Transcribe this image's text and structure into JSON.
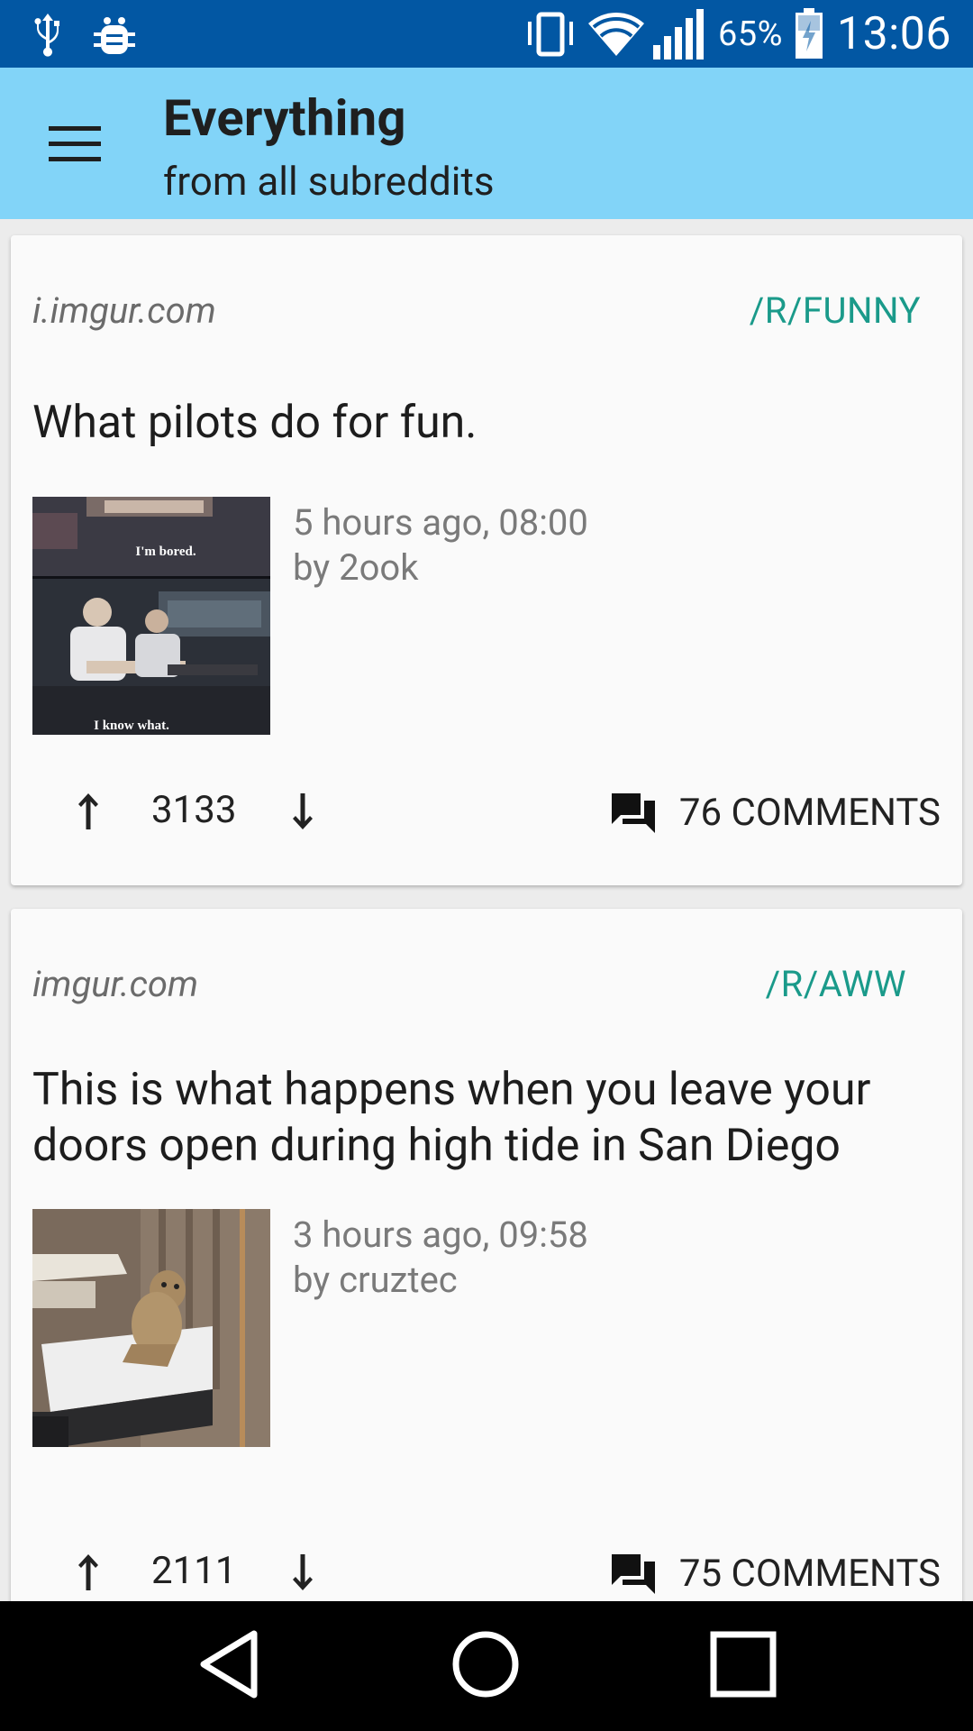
{
  "status_bar": {
    "icons_left": [
      "usb-icon",
      "bug-icon"
    ],
    "icons_right": [
      "vibrate-icon",
      "wifi-icon",
      "signal-icon",
      "battery-charging-icon"
    ],
    "battery_percent": "65%",
    "time": "13:06"
  },
  "app_bar": {
    "menu_icon": "hamburger-menu-icon",
    "title": "Everything",
    "subtitle": "from all subreddits"
  },
  "posts": [
    {
      "domain": "i.imgur.com",
      "subreddit": "/R/FUNNY",
      "title": "What pilots do for fun.",
      "thumbnail_caption_top": "I'm bored.",
      "thumbnail_caption_bottom": "I know what.",
      "time": "5 hours ago, 08:00",
      "author": "by 2ook",
      "score": "3133",
      "comments": "76 COMMENTS"
    },
    {
      "domain": "imgur.com",
      "subreddit": "/R/AWW",
      "title": "This is what happens when you leave your doors open during high tide in San Diego",
      "time": "3 hours ago, 09:58",
      "author": "by cruztec",
      "score": "2111",
      "comments": "75 COMMENTS"
    }
  ],
  "nav_bar": {
    "back_icon": "back-triangle-icon",
    "home_icon": "home-circle-icon",
    "recents_icon": "recents-square-icon"
  },
  "colors": {
    "status_bar": "#0257a3",
    "app_bar": "#82d4f8",
    "subreddit_accent": "#1a9a8a",
    "card_background": "#fafafa",
    "feed_background": "#ececec",
    "nav_bar": "#000000"
  }
}
